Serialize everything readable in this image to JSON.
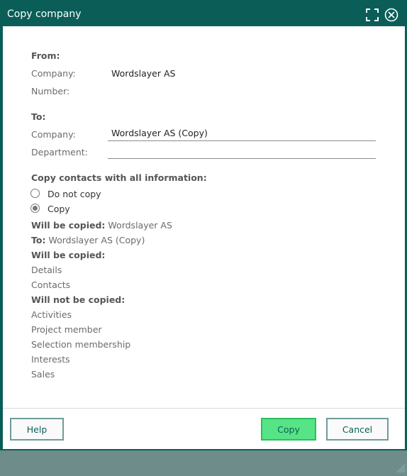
{
  "window": {
    "title": "Copy company",
    "maximize_icon": "maximize-icon",
    "close_icon": "close-circle-icon"
  },
  "from": {
    "heading": "From:",
    "company_label": "Company:",
    "company_value": "Wordslayer AS",
    "number_label": "Number:",
    "number_value": ""
  },
  "to": {
    "heading": "To:",
    "company_label": "Company:",
    "company_value": "Wordslayer AS (Copy)",
    "department_label": "Department:",
    "department_value": ""
  },
  "contacts": {
    "heading": "Copy contacts with all information:",
    "options": [
      {
        "label": "Do not copy",
        "checked": false
      },
      {
        "label": "Copy",
        "checked": true
      }
    ]
  },
  "summary": {
    "will_be_copied_label": "Will be copied:",
    "will_be_copied_value": "Wordslayer AS",
    "to_label": "To:",
    "to_value": "Wordslayer AS (Copy)",
    "copied_heading": "Will be copied:",
    "copied_items": [
      "Details",
      "Contacts"
    ],
    "not_copied_heading": "Will not be copied:",
    "not_copied_items": [
      "Activities",
      "Project member",
      "Selection membership",
      "Interests",
      "Sales"
    ]
  },
  "footer": {
    "help_label": "Help",
    "copy_label": "Copy",
    "cancel_label": "Cancel"
  },
  "colors": {
    "titlebar": "#0a5e57",
    "primary_button": "#57e486",
    "button_border": "#6e9b9a"
  }
}
